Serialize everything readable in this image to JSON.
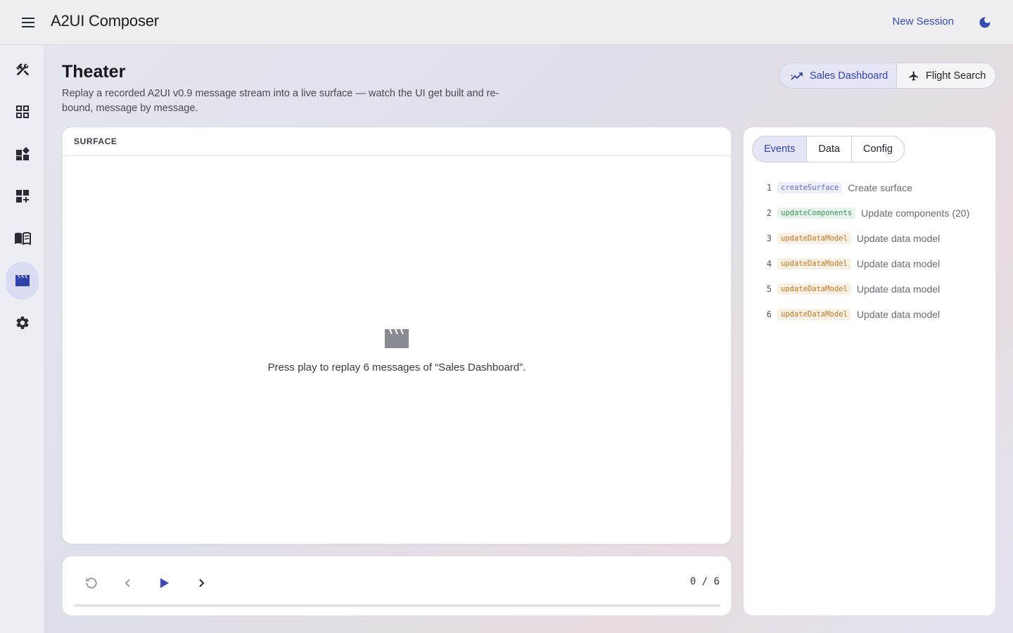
{
  "app": {
    "title": "A2UI Composer",
    "new_session": "New Session"
  },
  "sidebar": {
    "items": [
      {
        "icon": "tools-icon"
      },
      {
        "icon": "grid-icon"
      },
      {
        "icon": "widgets-icon"
      },
      {
        "icon": "dashboard-add-icon"
      },
      {
        "icon": "book-icon"
      },
      {
        "icon": "clapperboard-icon",
        "active": true
      },
      {
        "icon": "gear-icon"
      }
    ]
  },
  "header": {
    "title": "Theater",
    "description": "Replay a recorded A2UI v0.9 message stream into a live surface — watch the UI get built and re-bound, message by message.",
    "scenarios": [
      {
        "label": "Sales Dashboard",
        "icon": "trending-icon",
        "selected": true
      },
      {
        "label": "Flight Search",
        "icon": "airplane-icon",
        "selected": false
      }
    ]
  },
  "surface": {
    "label": "SURFACE",
    "empty_message": "Press play to replay 6 messages of “Sales Dashboard”."
  },
  "player": {
    "counter": "0 / 6",
    "progress": 0
  },
  "panel": {
    "tabs": [
      "Events",
      "Data",
      "Config"
    ],
    "active_tab": "Events",
    "events": [
      {
        "num": "1",
        "type": "createSurface",
        "desc": "Create surface",
        "color": "#6370c4"
      },
      {
        "num": "2",
        "type": "updateComponents",
        "desc": "Update components (20)",
        "color": "#3c9a5b"
      },
      {
        "num": "3",
        "type": "updateDataModel",
        "desc": "Update data model",
        "color": "#c0782c"
      },
      {
        "num": "4",
        "type": "updateDataModel",
        "desc": "Update data model",
        "color": "#c0782c"
      },
      {
        "num": "5",
        "type": "updateDataModel",
        "desc": "Update data model",
        "color": "#c0782c"
      },
      {
        "num": "6",
        "type": "updateDataModel",
        "desc": "Update data model",
        "color": "#c0782c"
      }
    ]
  },
  "colors": {
    "accent": "#3a4bb0",
    "active_bg": "#d9dcf3"
  }
}
